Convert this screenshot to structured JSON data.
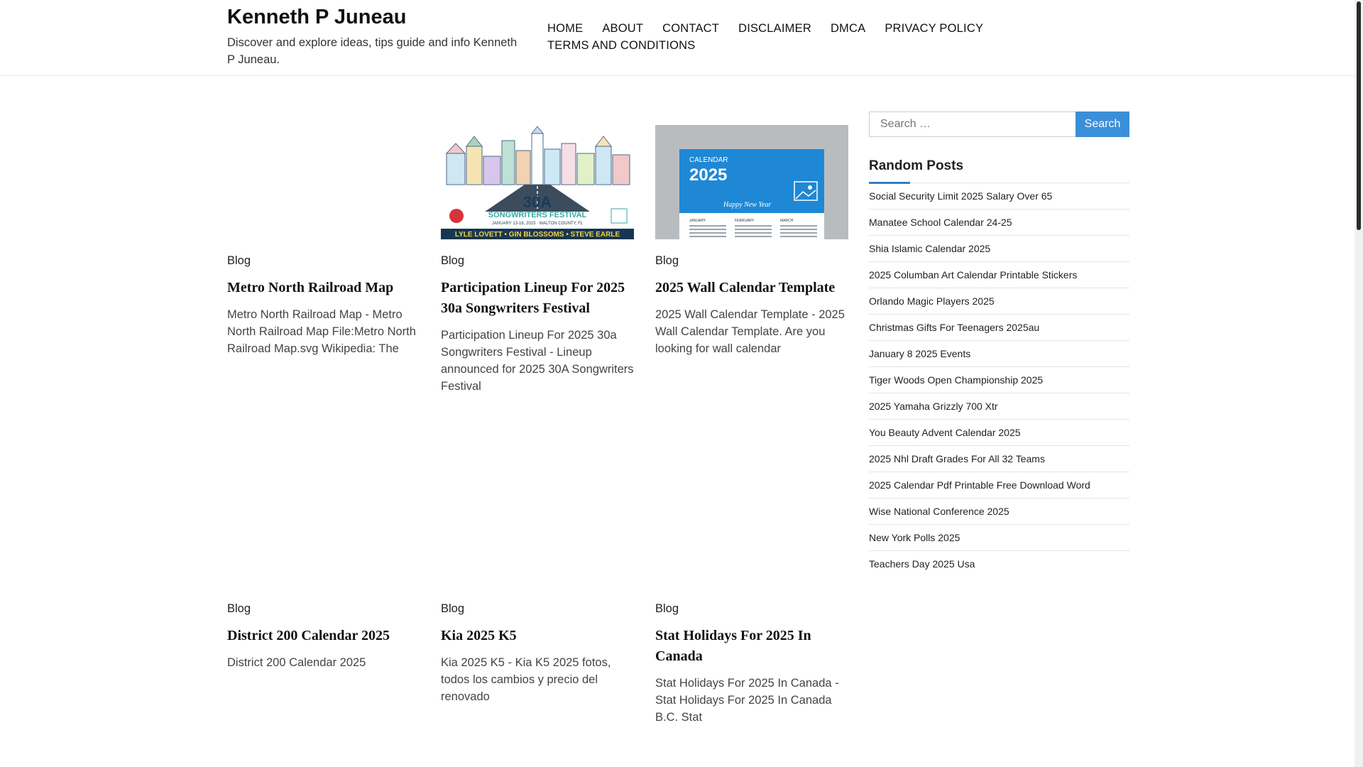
{
  "site": {
    "title": "Kenneth P Juneau",
    "description": "Discover and explore ideas, tips guide and info Kenneth P Juneau."
  },
  "nav": [
    "HOME",
    "ABOUT",
    "CONTACT",
    "DISCLAIMER",
    "DMCA",
    "PRIVACY POLICY",
    "TERMS AND CONDITIONS"
  ],
  "posts": [
    {
      "category": "Blog",
      "title": "Metro North Railroad Map",
      "excerpt": "Metro North Railroad Map - Metro North Railroad Map File:Metro North Railroad Map.svg Wikipedia: The",
      "thumbnail": "none"
    },
    {
      "category": "Blog",
      "title": "Participation Lineup For 2025 30a Songwriters Festival",
      "excerpt": "Participation Lineup For 2025 30a Songwriters Festival - Lineup announced for 2025 30A Songwriters Festival",
      "thumbnail": "festival-poster",
      "thumbnail_text": {
        "big": "30A",
        "name": "SONGWRITERS FESTIVAL",
        "dates": "JANUARY 13-16, 2023 · WALTON COUNTY, FL",
        "artists": "LYLE LOVETT • GIN BLOSSOMS • STEVE EARLE"
      }
    },
    {
      "category": "Blog",
      "title": "2025 Wall Calendar Template",
      "excerpt": "2025 Wall Calendar Template - 2025 Wall Calendar Template. Are you looking for wall calendar",
      "thumbnail": "calendar",
      "thumbnail_text": {
        "label": "CALENDAR",
        "year": "2025",
        "greeting": "Happy New Year",
        "months": [
          "JANUARY",
          "FEBRUARY",
          "MARCH"
        ]
      }
    },
    {
      "category": "Blog",
      "title": "District 200 Calendar 2025",
      "excerpt": "District 200 Calendar 2025",
      "thumbnail": "none"
    },
    {
      "category": "Blog",
      "title": "Kia 2025 K5",
      "excerpt": "Kia 2025 K5 - Kia K5 2025 fotos, todos los cambios y precio del renovado",
      "thumbnail": "none"
    },
    {
      "category": "Blog",
      "title": "Stat Holidays For 2025 In Canada",
      "excerpt": "Stat Holidays For 2025 In Canada - Stat Holidays For 2025 In Canada B.C. Stat",
      "thumbnail": "none"
    }
  ],
  "sidebar": {
    "search_placeholder": "Search …",
    "search_button": "Search",
    "widget_title": "Random Posts",
    "random_posts": [
      "Social Security Limit 2025 Salary Over 65",
      "Manatee School Calendar 24-25",
      "Shia Islamic Calendar 2025",
      "2025 Columban Art Calendar Printable Stickers",
      "Orlando Magic Players 2025",
      "Christmas Gifts For Teenagers 2025au",
      "January 8 2025 Events",
      "Tiger Woods Open Championship 2025",
      "2025 Yamaha Grizzly 700 Xtr",
      "You Beauty Advent Calendar 2025",
      "2025 Nhl Draft Grades For All 32 Teams",
      "2025 Calendar Pdf Printable Free Download Word",
      "Wise National Conference 2025",
      "New York Polls 2025",
      "Teachers Day 2025 Usa"
    ]
  },
  "colors": {
    "accent": "#3b8fd9",
    "calendar_blue": "#1e88d6",
    "thumb_gray": "#b9bcbf"
  }
}
